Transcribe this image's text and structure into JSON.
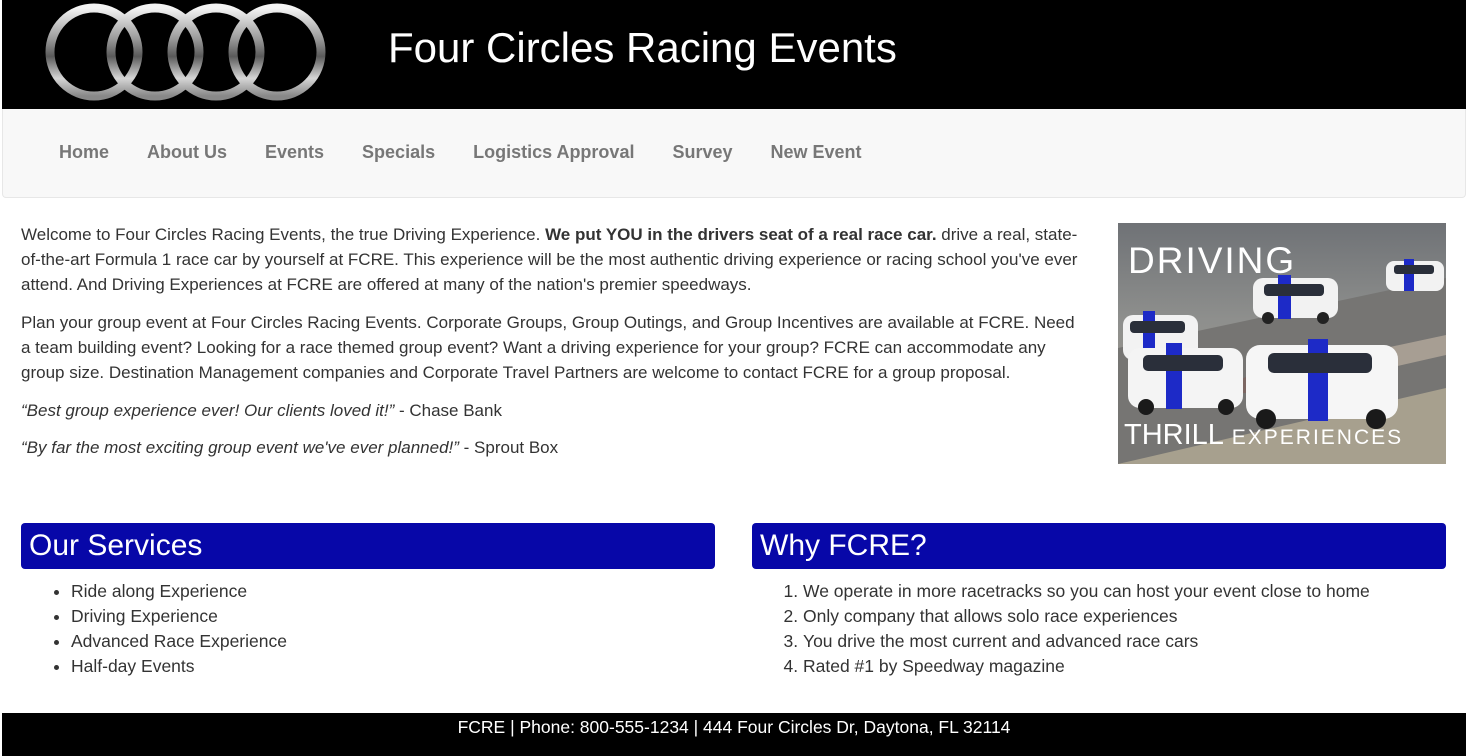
{
  "header": {
    "title": "Four Circles Racing Events",
    "logo_icon": "four-rings-logo"
  },
  "nav": {
    "items": [
      {
        "label": "Home"
      },
      {
        "label": "About Us"
      },
      {
        "label": "Events"
      },
      {
        "label": "Specials"
      },
      {
        "label": "Logistics Approval"
      },
      {
        "label": "Survey"
      },
      {
        "label": "New Event"
      }
    ]
  },
  "intro": {
    "p1_start": "Welcome to Four Circles Racing Events, the true Driving Experience. ",
    "p1_bold": "We put YOU in the drivers seat of a real race car.",
    "p1_end": " drive a real, state-of-the-art Formula 1 race car by yourself at FCRE. This experience will be the most authentic driving experience or racing school you've ever attend. And Driving Experiences at FCRE are offered at many of the nation's premier speedways.",
    "p2": "Plan your group event at Four Circles Racing Events. Corporate Groups, Group Outings, and Group Incentives are available at FCRE. Need a team building event? Looking for a race themed group event? Want a driving experience for your group? FCRE can accommodate any group size. Destination Management companies and Corporate Travel Partners are welcome to contact FCRE for a group proposal.",
    "quotes": [
      {
        "text": "“Best group experience ever! Our clients loved it!”",
        "source": " - Chase Bank"
      },
      {
        "text": "“By far the most exciting group event we've ever planned!”",
        "source": " - Sprout Box"
      }
    ]
  },
  "hero": {
    "line1": "DRIVING",
    "line2a": "THRILL",
    "line2b": " EXPERIENCES"
  },
  "services": {
    "heading": "Our Services",
    "items": [
      "Ride along Experience",
      "Driving Experience",
      "Advanced Race Experience",
      "Half-day Events"
    ]
  },
  "why": {
    "heading": "Why FCRE?",
    "items": [
      "We operate in more racetracks so you can host your event close to home",
      "Only company that allows solo race experiences",
      "You drive the most current and advanced race cars",
      "Rated #1 by Speedway magazine"
    ]
  },
  "footer": {
    "text": "FCRE | Phone: 800-555-1234 | 444 Four Circles Dr, Daytona, FL 32114"
  },
  "colors": {
    "header_bg": "#000000",
    "panel_heading_bg": "#0707a8",
    "nav_text": "#777777"
  }
}
